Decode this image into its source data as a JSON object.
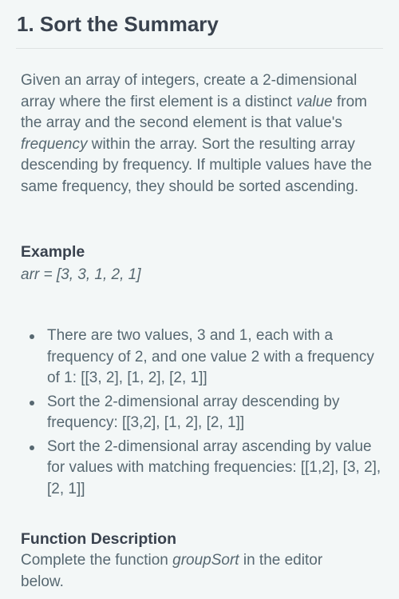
{
  "title": "1. Sort the Summary",
  "description": {
    "part1": "Given an array of integers, create a 2-dimensional array where the first element is a distinct ",
    "value_word": "value",
    "part2": " from the array and the second element is that value's ",
    "frequency_word": "frequency",
    "part3": " within the array.  Sort the resulting array descending by frequency.  If multiple values have the same frequency, they should be sorted ascending."
  },
  "example": {
    "heading": "Example",
    "arr_line": "arr = [3, 3, 1, 2, 1]"
  },
  "bullets": [
    "There are two values, 3 and 1, each with a frequency of 2, and one value 2 with a frequency of 1: [[3, 2], [1, 2], [2, 1]]",
    "Sort the 2-dimensional array descending by frequency: [[3,2], [1, 2], [2, 1]]",
    "Sort the 2-dimensional array ascending by value for values with matching frequencies: [[1,2], [3, 2], [2, 1]]"
  ],
  "function_description": {
    "heading": "Function Description",
    "part1": "Complete the function ",
    "function_name": "groupSort",
    "part2": " in the editor below."
  }
}
